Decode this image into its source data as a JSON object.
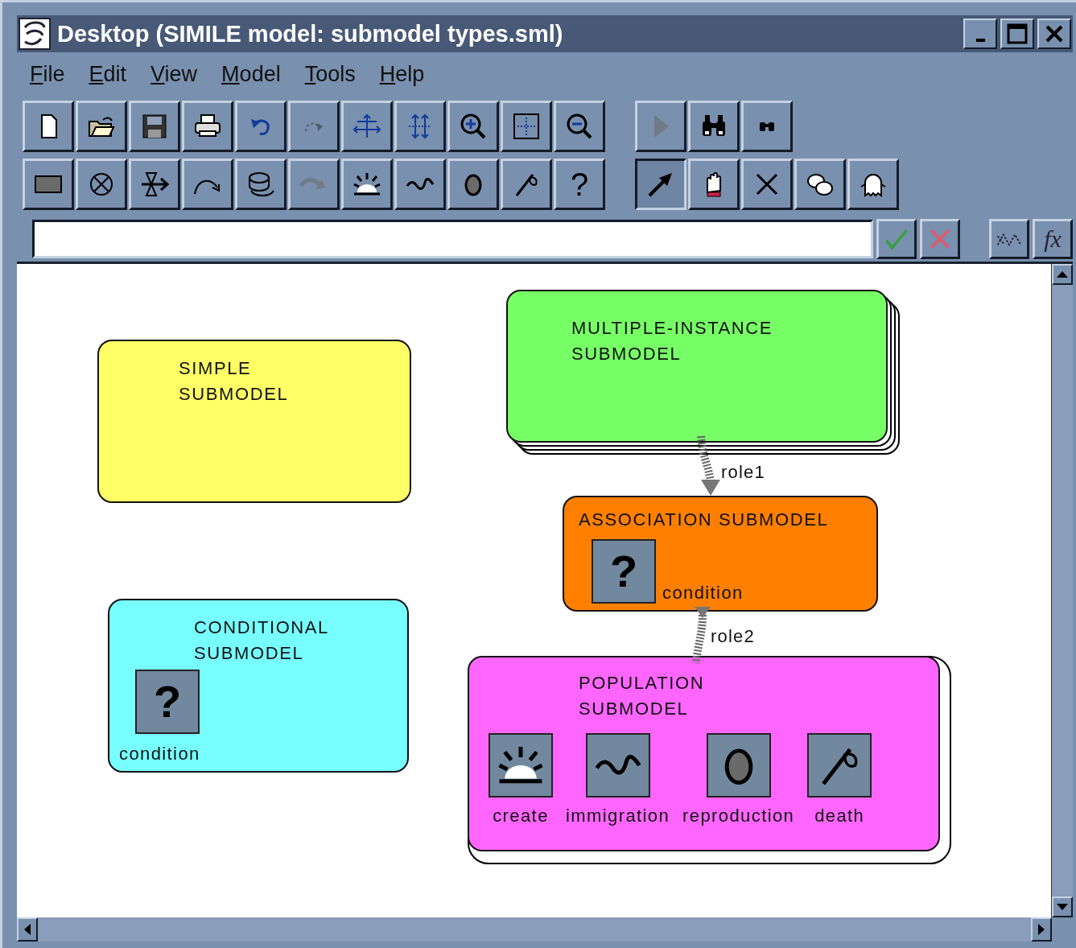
{
  "window": {
    "title": "Desktop (SIMILE model: submodel types.sml)"
  },
  "menu": [
    "File",
    "Edit",
    "View",
    "Model",
    "Tools",
    "Help"
  ],
  "toolbar_rows": [
    [
      [
        {
          "kind": "new",
          "disabled": false
        },
        {
          "kind": "open",
          "disabled": false
        },
        {
          "kind": "save",
          "disabled": false
        },
        {
          "kind": "print",
          "disabled": false
        },
        {
          "kind": "undo",
          "disabled": false
        },
        {
          "kind": "redo",
          "disabled": true
        },
        {
          "kind": "spread",
          "disabled": false
        },
        {
          "kind": "stretch",
          "disabled": false
        },
        {
          "kind": "zoomin",
          "disabled": false
        },
        {
          "kind": "fit",
          "disabled": false
        },
        {
          "kind": "zoomout",
          "disabled": false
        }
      ],
      [
        {
          "kind": "run",
          "disabled": true
        },
        {
          "kind": "find",
          "disabled": false
        },
        {
          "kind": "findnext",
          "disabled": false
        }
      ]
    ],
    [
      [
        {
          "kind": "compartment",
          "disabled": false
        },
        {
          "kind": "source",
          "disabled": false
        },
        {
          "kind": "flow",
          "disabled": false
        },
        {
          "kind": "influence",
          "disabled": false
        },
        {
          "kind": "submodel",
          "disabled": false
        },
        {
          "kind": "role",
          "disabled": true
        },
        {
          "kind": "creation",
          "disabled": false
        },
        {
          "kind": "immigration",
          "disabled": false
        },
        {
          "kind": "reproduction",
          "disabled": false
        },
        {
          "kind": "death",
          "disabled": false
        },
        {
          "kind": "condition",
          "symbol": "?",
          "disabled": false
        }
      ],
      [
        {
          "kind": "pointer",
          "selected": true
        },
        {
          "kind": "hand",
          "selected": false
        },
        {
          "kind": "delete",
          "selected": false
        },
        {
          "kind": "clouds",
          "selected": false
        },
        {
          "kind": "ghost",
          "selected": false
        }
      ]
    ]
  ],
  "expression_bar": {
    "buttons": [
      {
        "kind": "accept"
      },
      {
        "kind": "reject"
      },
      {
        "kind": "variables"
      },
      {
        "kind": "function",
        "symbol": "fx"
      }
    ]
  },
  "canvas": {
    "submodels": [
      {
        "kind": "simple",
        "title": "SIMPLE SUBMODEL",
        "color": "#ffff66"
      },
      {
        "kind": "multiple",
        "title": "MULTIPLE-INSTANCE SUBMODEL",
        "color": "#77ff66"
      },
      {
        "kind": "association",
        "title": "ASSOCIATION SUBMODEL",
        "color": "#ff7f00",
        "components": [
          {
            "kind": "condition",
            "symbol": "?",
            "label": "condition"
          }
        ]
      },
      {
        "kind": "conditional",
        "title": "CONDITIONAL SUBMODEL",
        "color": "#77ffff",
        "components": [
          {
            "kind": "condition",
            "symbol": "?",
            "label": "condition"
          }
        ]
      },
      {
        "kind": "population",
        "title": "POPULATION SUBMODEL",
        "color": "#ff66ff",
        "components": [
          {
            "kind": "creation",
            "label": "create"
          },
          {
            "kind": "immigration",
            "label": "immigration"
          },
          {
            "kind": "reproduction",
            "label": "reproduction"
          },
          {
            "kind": "death",
            "label": "death"
          }
        ]
      }
    ],
    "connectors": [
      {
        "label": "role1"
      },
      {
        "label": "role2"
      }
    ]
  }
}
